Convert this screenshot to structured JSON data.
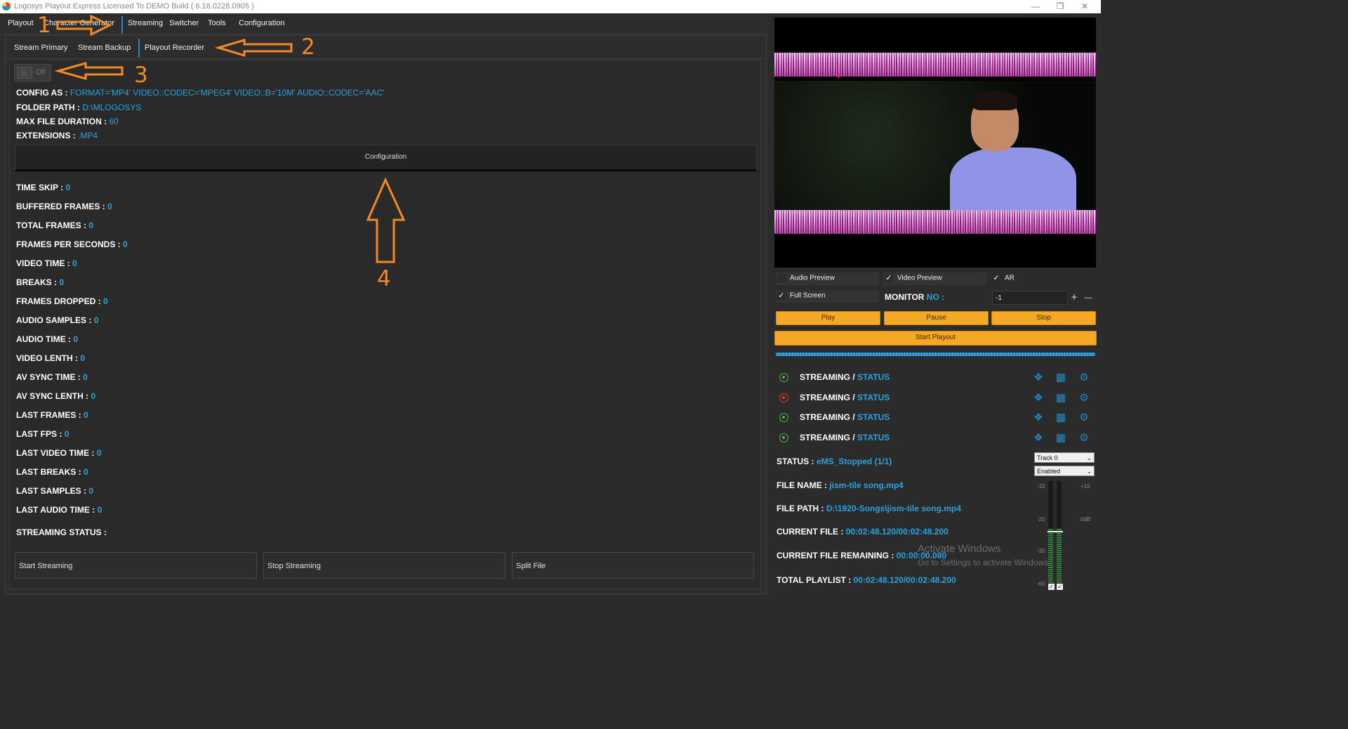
{
  "window": {
    "title": "Logosys Playout Express Licensed To DEMO Build ( 6.16.0228.0905 )",
    "minimize": "—",
    "maximize": "❐",
    "close": "✕"
  },
  "menu": {
    "items": [
      "Playout",
      "Character Generator",
      "Streaming",
      "Switcher",
      "Tools",
      "Configuration"
    ],
    "active": "Streaming"
  },
  "subtabs": {
    "items": [
      "Stream Primary",
      "Stream Backup",
      "Playout Recorder"
    ],
    "active": "Playout Recorder"
  },
  "toggle": {
    "label": "Off",
    "state": "off"
  },
  "config": {
    "config_as_label": "CONFIG AS :",
    "config_as_value": "FORMAT='MP4' VIDEO::CODEC='MPEG4' VIDEO::B='10M' AUDIO::CODEC='AAC'",
    "folder_path_label": "FOLDER PATH  :",
    "folder_path_value": "D:\\MLOGOSYS",
    "max_duration_label": "MAX FILE DURATION :",
    "max_duration_value": "60",
    "extensions_label": "EXTENSIONS :",
    "extensions_value": ".MP4",
    "button": "Configuration"
  },
  "stats": [
    {
      "label": "TIME SKIP :",
      "value": "0"
    },
    {
      "label": "BUFFERED FRAMES :",
      "value": "0"
    },
    {
      "label": "TOTAL FRAMES :",
      "value": "0"
    },
    {
      "label": "FRAMES PER SECONDS :",
      "value": "0"
    },
    {
      "label": "VIDEO TIME :",
      "value": "0"
    },
    {
      "label": "BREAKS :",
      "value": "0"
    },
    {
      "label": "FRAMES DROPPED :",
      "value": "0"
    },
    {
      "label": "AUDIO SAMPLES :",
      "value": "0"
    },
    {
      "label": "AUDIO TIME :",
      "value": "0"
    },
    {
      "label": "VIDEO LENTH :",
      "value": "0"
    },
    {
      "label": "AV SYNC TIME :",
      "value": "0"
    },
    {
      "label": "AV SYNC LENTH :",
      "value": "0"
    },
    {
      "label": "LAST FRAMES :",
      "value": "0"
    },
    {
      "label": "LAST FPS :",
      "value": "0"
    },
    {
      "label": "LAST VIDEO TIME :",
      "value": "0"
    },
    {
      "label": "LAST BREAKS :",
      "value": "0"
    },
    {
      "label": "LAST SAMPLES :",
      "value": "0"
    },
    {
      "label": "LAST AUDIO TIME :",
      "value": "0"
    }
  ],
  "streaming_status_label": "STREAMING STATUS :",
  "bottom_buttons": [
    "Start Streaming",
    "Stop Streaming",
    "Split File"
  ],
  "annotations": [
    "1",
    "2",
    "3",
    "4"
  ],
  "right": {
    "checkboxes": {
      "audio_preview": {
        "label": "Audio Preview",
        "checked": false
      },
      "video_preview": {
        "label": "Video Preview",
        "checked": true
      },
      "ar": {
        "label": "AR",
        "checked": true
      },
      "full_screen": {
        "label": "Full Screen",
        "checked": true
      }
    },
    "monitor_label": "MONITOR",
    "monitor_no": "NO :",
    "monitor_value": "-1",
    "plus": "+",
    "minus": "—",
    "buttons": {
      "play": "Play",
      "pause": "Pause",
      "stop": "Stop",
      "start_playout": "Start Playout"
    },
    "streams": [
      {
        "label": "STREAMING /",
        "status": "STATUS",
        "indicator": "#4caf50"
      },
      {
        "label": "STREAMING /",
        "status": "STATUS",
        "indicator": "#e53935"
      },
      {
        "label": "STREAMING /",
        "status": "STATUS",
        "indicator": "#4caf50"
      },
      {
        "label": "STREAMING /",
        "status": "STATUS",
        "indicator": "#4caf50"
      }
    ],
    "status_label": "STATUS :",
    "status_value": "eMS_Stopped (1/1)",
    "file_name_label": "FILE NAME :",
    "file_name_value": "jism-tile song.mp4",
    "file_path_label": "FILE PATH :",
    "file_path_value": "D:\\1920-Songs\\jism-tile song.mp4",
    "current_file_label": "CURRENT FILE :",
    "current_file_value": "00:02:48.120/00:02:48.200",
    "remaining_label": "CURRENT FILE REMAINING :",
    "remaining_value": "00:00:00.080",
    "total_playlist_label": "TOTAL PLAYLIST :",
    "total_playlist_value": "00:02:48.120/00:02:48.200",
    "track_select": "Track 0",
    "enabled_select": "Enabled",
    "vu_scale_left": [
      "-10",
      "-20",
      "-30",
      "-60"
    ],
    "vu_scale_right": [
      "+10",
      "0dB"
    ],
    "watermark_title": "Activate Windows",
    "watermark_sub": "Go to Settings to activate Windows."
  },
  "colors": {
    "accent": "#29a3e0",
    "orange": "#f4a824",
    "annotation": "#f08a24"
  }
}
